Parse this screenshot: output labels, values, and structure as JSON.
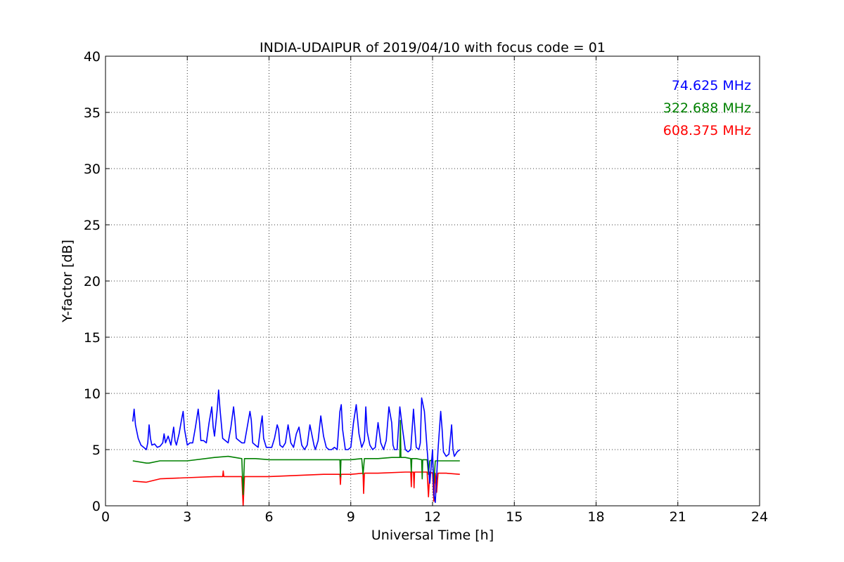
{
  "chart_data": {
    "type": "line",
    "title": "INDIA-UDAIPUR of 2019/04/10 with focus code = 01",
    "xlabel": "Universal Time [h]",
    "ylabel": "Y-factor [dB]",
    "xlim": [
      0,
      24
    ],
    "ylim": [
      0,
      40
    ],
    "xticks": [
      "0",
      "3",
      "6",
      "9",
      "12",
      "15",
      "18",
      "21",
      "24"
    ],
    "yticks": [
      "0",
      "5",
      "10",
      "15",
      "20",
      "25",
      "30",
      "35",
      "40"
    ],
    "grid": true,
    "legend_placement": "top-right",
    "series": [
      {
        "name": "74.625 MHz",
        "color": "#0000ff",
        "x": [
          1.0,
          1.05,
          1.1,
          1.2,
          1.3,
          1.4,
          1.5,
          1.55,
          1.6,
          1.65,
          1.7,
          1.8,
          1.9,
          2.0,
          2.1,
          2.15,
          2.2,
          2.3,
          2.4,
          2.5,
          2.55,
          2.6,
          2.7,
          2.8,
          2.85,
          2.9,
          3.0,
          3.1,
          3.2,
          3.3,
          3.4,
          3.45,
          3.5,
          3.6,
          3.7,
          3.8,
          3.9,
          3.95,
          4.0,
          4.1,
          4.15,
          4.2,
          4.3,
          4.4,
          4.5,
          4.6,
          4.7,
          4.75,
          4.8,
          4.9,
          5.0,
          5.1,
          5.2,
          5.3,
          5.35,
          5.4,
          5.5,
          5.6,
          5.7,
          5.75,
          5.8,
          5.9,
          6.0,
          6.1,
          6.2,
          6.3,
          6.35,
          6.4,
          6.5,
          6.6,
          6.7,
          6.8,
          6.9,
          7.0,
          7.1,
          7.2,
          7.3,
          7.4,
          7.5,
          7.6,
          7.65,
          7.7,
          7.8,
          7.9,
          8.0,
          8.1,
          8.2,
          8.3,
          8.4,
          8.5,
          8.6,
          8.65,
          8.7,
          8.8,
          8.9,
          9.0,
          9.1,
          9.2,
          9.3,
          9.4,
          9.5,
          9.55,
          9.6,
          9.7,
          9.8,
          9.9,
          10.0,
          10.1,
          10.2,
          10.3,
          10.4,
          10.5,
          10.55,
          10.6,
          10.7,
          10.8,
          10.9,
          11.0,
          11.1,
          11.2,
          11.3,
          11.4,
          11.5,
          11.55,
          11.6,
          11.7,
          11.8,
          11.9,
          12.0,
          12.05,
          12.1,
          12.2,
          12.3,
          12.35,
          12.4,
          12.5,
          12.6,
          12.7,
          12.75,
          12.8,
          12.9,
          13.0
        ],
        "y": [
          7.5,
          8.6,
          7.2,
          6.0,
          5.4,
          5.2,
          5.0,
          5.6,
          7.2,
          6.0,
          5.4,
          5.5,
          5.2,
          5.3,
          5.6,
          6.4,
          5.6,
          6.2,
          5.4,
          7.0,
          5.8,
          5.4,
          6.4,
          7.8,
          8.4,
          6.8,
          5.4,
          5.6,
          5.6,
          7.0,
          8.6,
          7.4,
          5.8,
          5.8,
          5.6,
          7.4,
          8.8,
          7.0,
          6.2,
          8.6,
          10.3,
          8.6,
          6.0,
          5.8,
          5.6,
          7.0,
          8.8,
          7.6,
          6.0,
          5.8,
          5.6,
          5.6,
          7.0,
          8.4,
          7.6,
          5.6,
          5.4,
          5.2,
          7.2,
          8.0,
          6.0,
          5.2,
          5.2,
          5.2,
          6.0,
          7.2,
          6.8,
          5.4,
          5.2,
          5.6,
          7.2,
          5.6,
          5.2,
          6.4,
          7.0,
          5.4,
          5.0,
          5.4,
          7.2,
          6.0,
          5.4,
          5.0,
          5.8,
          8.0,
          6.2,
          5.2,
          5.0,
          5.0,
          5.2,
          5.0,
          8.4,
          9.0,
          6.8,
          5.0,
          5.0,
          5.2,
          7.4,
          9.0,
          6.4,
          5.2,
          5.8,
          8.8,
          6.6,
          5.4,
          5.0,
          5.2,
          7.4,
          5.6,
          5.0,
          5.8,
          8.8,
          7.4,
          5.4,
          5.0,
          5.0,
          8.8,
          6.8,
          5.0,
          4.8,
          5.0,
          8.6,
          5.2,
          5.0,
          5.6,
          9.6,
          8.4,
          5.0,
          2.0,
          5.0,
          1.0,
          0.3,
          5.0,
          8.4,
          6.8,
          4.8,
          4.4,
          4.6,
          7.2,
          5.0,
          4.4,
          4.8,
          5.0
        ]
      },
      {
        "name": "322.688 MHz",
        "color": "#008000",
        "x": [
          1.0,
          1.5,
          1.6,
          2.0,
          3.0,
          4.0,
          4.5,
          5.0,
          5.05,
          5.1,
          5.5,
          6.0,
          7.0,
          8.0,
          8.6,
          8.62,
          8.64,
          9.0,
          9.4,
          9.45,
          9.5,
          10.0,
          10.5,
          10.8,
          10.82,
          10.84,
          11.0,
          11.2,
          11.22,
          11.24,
          11.4,
          11.6,
          11.62,
          11.64,
          11.8,
          11.85,
          11.9,
          12.0,
          12.05,
          12.1,
          12.2,
          12.5,
          13.0
        ],
        "y": [
          4.0,
          3.8,
          3.8,
          4.0,
          4.0,
          4.3,
          4.4,
          4.2,
          1.0,
          4.2,
          4.2,
          4.1,
          4.1,
          4.1,
          4.1,
          2.6,
          4.1,
          4.1,
          4.2,
          2.8,
          4.2,
          4.2,
          4.3,
          4.3,
          7.6,
          4.3,
          4.3,
          4.2,
          3.0,
          4.2,
          4.2,
          4.1,
          2.4,
          4.1,
          4.1,
          2.8,
          4.0,
          4.1,
          2.0,
          4.0,
          4.0,
          4.0,
          4.0
        ]
      },
      {
        "name": "608.375 MHz",
        "color": "#ff0000",
        "x": [
          1.0,
          1.5,
          2.0,
          3.0,
          4.0,
          4.3,
          4.32,
          4.34,
          5.0,
          5.05,
          5.1,
          6.0,
          7.0,
          8.0,
          8.6,
          8.62,
          8.64,
          9.0,
          9.45,
          9.47,
          9.5,
          10.0,
          11.0,
          11.2,
          11.22,
          11.24,
          11.3,
          11.32,
          11.34,
          11.8,
          11.85,
          11.9,
          12.0,
          12.05,
          12.1,
          12.15,
          12.2,
          12.5,
          13.0
        ],
        "y": [
          2.2,
          2.1,
          2.4,
          2.5,
          2.6,
          2.6,
          3.1,
          2.6,
          2.6,
          0.0,
          2.6,
          2.6,
          2.7,
          2.8,
          2.8,
          1.9,
          2.8,
          2.8,
          2.9,
          1.1,
          2.9,
          2.9,
          3.0,
          3.0,
          1.7,
          3.0,
          3.0,
          1.6,
          3.0,
          3.0,
          0.8,
          3.0,
          2.9,
          0.4,
          2.9,
          1.2,
          2.9,
          2.9,
          2.8
        ]
      }
    ]
  }
}
